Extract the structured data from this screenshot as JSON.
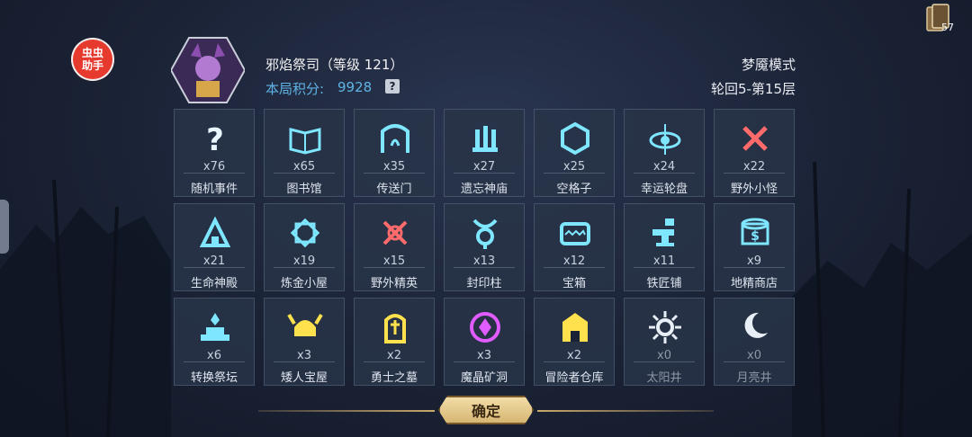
{
  "helper_badge": {
    "label": "虫虫助手"
  },
  "top_right": {
    "card_count": "57"
  },
  "hero": {
    "name": "邪焰祭司（等级 121）",
    "score_label": "本局积分:",
    "score_value": "9928",
    "help": "?"
  },
  "mode": {
    "title": "梦魇模式",
    "round": "轮回5-第15层"
  },
  "tiles": [
    {
      "count": "x76",
      "name": "随机事件",
      "icon": "question-icon",
      "color": "#e8f6ff"
    },
    {
      "count": "x65",
      "name": "图书馆",
      "icon": "book-icon",
      "color": "#7fe6ff"
    },
    {
      "count": "x35",
      "name": "传送门",
      "icon": "portal-icon",
      "color": "#7fe6ff"
    },
    {
      "count": "x27",
      "name": "遗忘神庙",
      "icon": "temple-icon",
      "color": "#7fe6ff"
    },
    {
      "count": "x25",
      "name": "空格子",
      "icon": "hexagon-icon",
      "color": "#7fe6ff"
    },
    {
      "count": "x24",
      "name": "幸运轮盘",
      "icon": "wheel-icon",
      "color": "#7fe6ff"
    },
    {
      "count": "x22",
      "name": "野外小怪",
      "icon": "crossed-swords-icon",
      "color": "#ff6b6b"
    },
    {
      "count": "x21",
      "name": "生命神殿",
      "icon": "life-temple-icon",
      "color": "#7fe6ff"
    },
    {
      "count": "x19",
      "name": "炼金小屋",
      "icon": "alchemy-icon",
      "color": "#7fe6ff"
    },
    {
      "count": "x15",
      "name": "野外精英",
      "icon": "crossed-axes-icon",
      "color": "#ff6b6b"
    },
    {
      "count": "x13",
      "name": "封印柱",
      "icon": "seal-icon",
      "color": "#7fe6ff"
    },
    {
      "count": "x12",
      "name": "宝箱",
      "icon": "mimic-chest-icon",
      "color": "#7fe6ff"
    },
    {
      "count": "x11",
      "name": "铁匠铺",
      "icon": "anvil-icon",
      "color": "#7fe6ff"
    },
    {
      "count": "x9",
      "name": "地精商店",
      "icon": "shop-icon",
      "color": "#7fe6ff"
    },
    {
      "count": "x6",
      "name": "转换祭坛",
      "icon": "altar-icon",
      "color": "#7fe6ff"
    },
    {
      "count": "x3",
      "name": "矮人宝屋",
      "icon": "helmet-icon",
      "color": "#ffe14d"
    },
    {
      "count": "x2",
      "name": "勇士之墓",
      "icon": "tomb-icon",
      "color": "#ffe14d"
    },
    {
      "count": "x3",
      "name": "魔晶矿洞",
      "icon": "crystal-mine-icon",
      "color": "#e05cff"
    },
    {
      "count": "x2",
      "name": "冒险者仓库",
      "icon": "warehouse-icon",
      "color": "#ffe14d"
    },
    {
      "count": "x0",
      "name": "太阳井",
      "icon": "sun-icon",
      "color": "#e8eef5",
      "dim": true
    },
    {
      "count": "x0",
      "name": "月亮井",
      "icon": "moon-icon",
      "color": "#e8eef5",
      "dim": true
    }
  ],
  "confirm": {
    "label": "确定"
  }
}
